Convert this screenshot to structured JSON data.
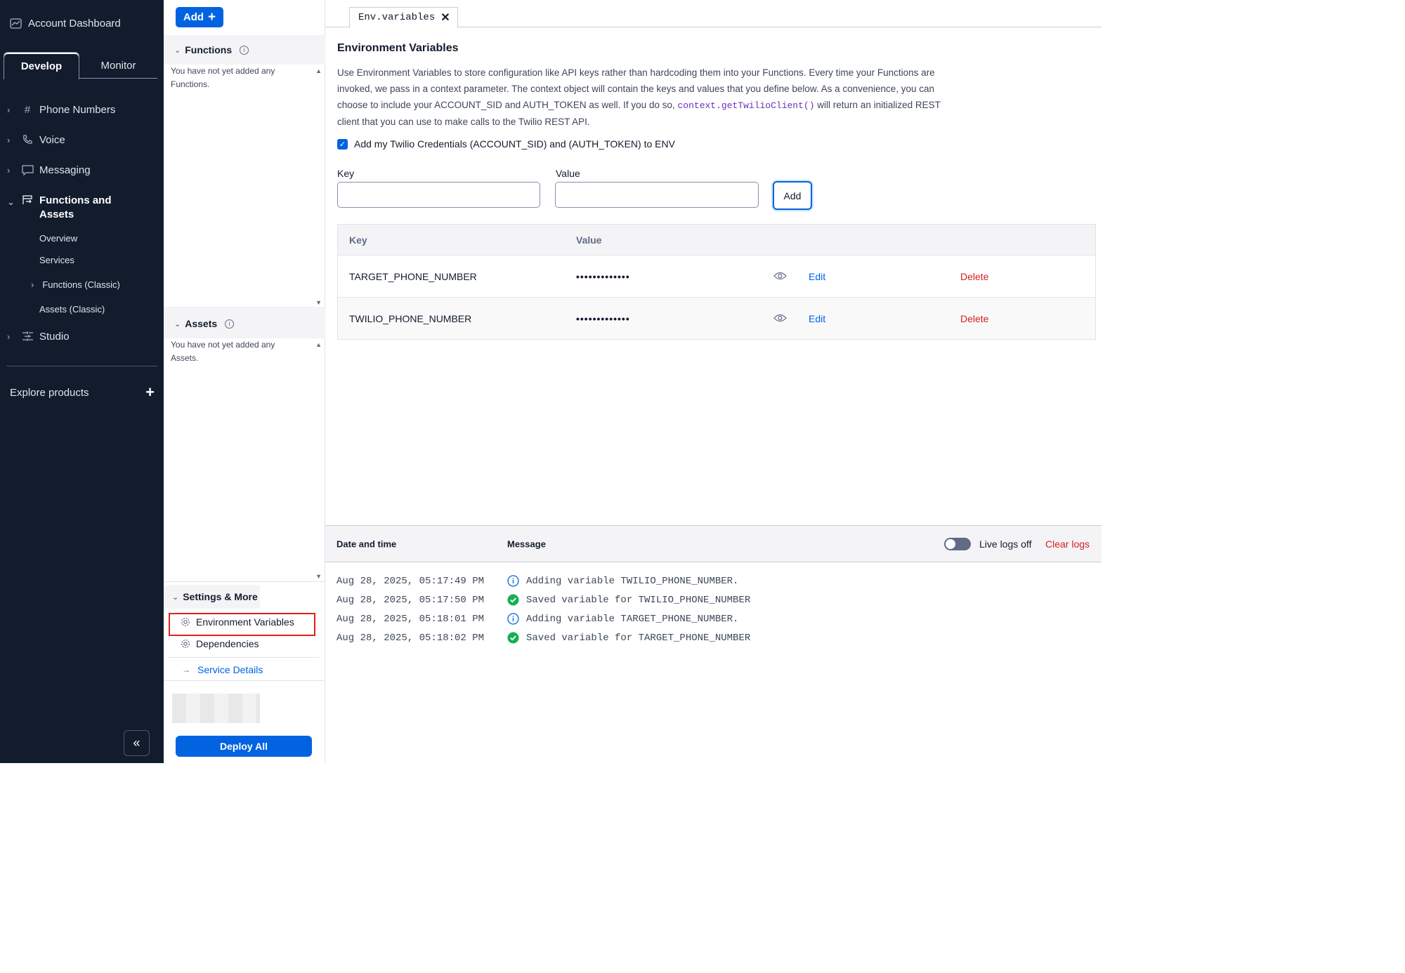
{
  "sidebar": {
    "title": "Account Dashboard",
    "tabs": [
      "Develop",
      "Monitor"
    ],
    "nav": [
      {
        "label": "Phone Numbers"
      },
      {
        "label": "Voice"
      },
      {
        "label": "Messaging"
      },
      {
        "label": "Functions and Assets"
      },
      {
        "label": "Studio"
      }
    ],
    "sub": [
      "Overview",
      "Services",
      "Functions (Classic)",
      "Assets (Classic)"
    ],
    "explore": "Explore products"
  },
  "mid": {
    "add_label": "Add",
    "functions_title": "Functions",
    "functions_empty": "You have not yet added any Functions.",
    "assets_title": "Assets",
    "assets_empty": "You have not yet added any Assets.",
    "settings_title": "Settings & More",
    "env_vars": "Environment Variables",
    "dependencies": "Dependencies",
    "service_details": "Service Details",
    "deploy_all": "Deploy All"
  },
  "editor": {
    "tab_label": "Env.variables",
    "title": "Environment Variables",
    "desc_1": "Use Environment Variables to store configuration like API keys rather than hardcoding them into your Functions. Every time your Functions are invoked, we pass in a context parameter. The context object will contain the keys and values that you define below. As a convenience, you can choose to include your ACCOUNT_SID and AUTH_TOKEN as well. If you do so,",
    "desc_code": "context.getTwilioClient()",
    "desc_2": "will return an initialized REST client that you can use to make calls to the Twilio REST API.",
    "checkbox_label": "Add my Twilio Credentials (ACCOUNT_SID) and (AUTH_TOKEN) to ENV",
    "key_label": "Key",
    "value_label": "Value",
    "add_button": "Add",
    "table_headers": [
      "Key",
      "Value"
    ],
    "rows": [
      {
        "key": "TARGET_PHONE_NUMBER",
        "value": "•••••••••••••",
        "edit": "Edit",
        "delete": "Delete"
      },
      {
        "key": "TWILIO_PHONE_NUMBER",
        "value": "•••••••••••••",
        "edit": "Edit",
        "delete": "Delete"
      }
    ]
  },
  "logs": {
    "col_date": "Date and time",
    "col_message": "Message",
    "live_label": "Live logs off",
    "clear_label": "Clear logs",
    "entries": [
      {
        "time": "Aug 28, 2025, 05:17:49 PM",
        "msg": "Adding variable TWILIO_PHONE_NUMBER.",
        "kind": "info"
      },
      {
        "time": "Aug 28, 2025, 05:17:50 PM",
        "msg": "Saved variable for TWILIO_PHONE_NUMBER",
        "kind": "success"
      },
      {
        "time": "Aug 28, 2025, 05:18:01 PM",
        "msg": "Adding variable TARGET_PHONE_NUMBER.",
        "kind": "info"
      },
      {
        "time": "Aug 28, 2025, 05:18:02 PM",
        "msg": "Saved variable for TARGET_PHONE_NUMBER",
        "kind": "success"
      }
    ]
  },
  "colors": {
    "accent": "#0263e0",
    "danger": "#d61f1f",
    "sidebar_bg": "#121c2d",
    "success": "#14b053"
  }
}
